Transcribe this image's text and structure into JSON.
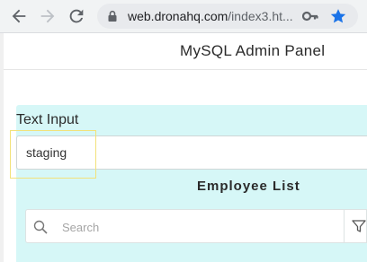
{
  "browser": {
    "url_host": "web.dronahq.com",
    "url_path": "/index3.ht..."
  },
  "app": {
    "title": "MySQL Admin Panel"
  },
  "text_input": {
    "label": "Text Input",
    "value": "staging"
  },
  "employee_list": {
    "title": "Employee List",
    "search_placeholder": "Search"
  },
  "colors": {
    "container_bg": "#d6f7f7",
    "highlight_border": "#f2e27a",
    "star": "#1a73e8"
  },
  "icons": [
    "back-arrow-icon",
    "forward-arrow-icon",
    "reload-icon",
    "lock-icon",
    "key-icon",
    "star-icon",
    "search-icon",
    "filter-icon"
  ]
}
